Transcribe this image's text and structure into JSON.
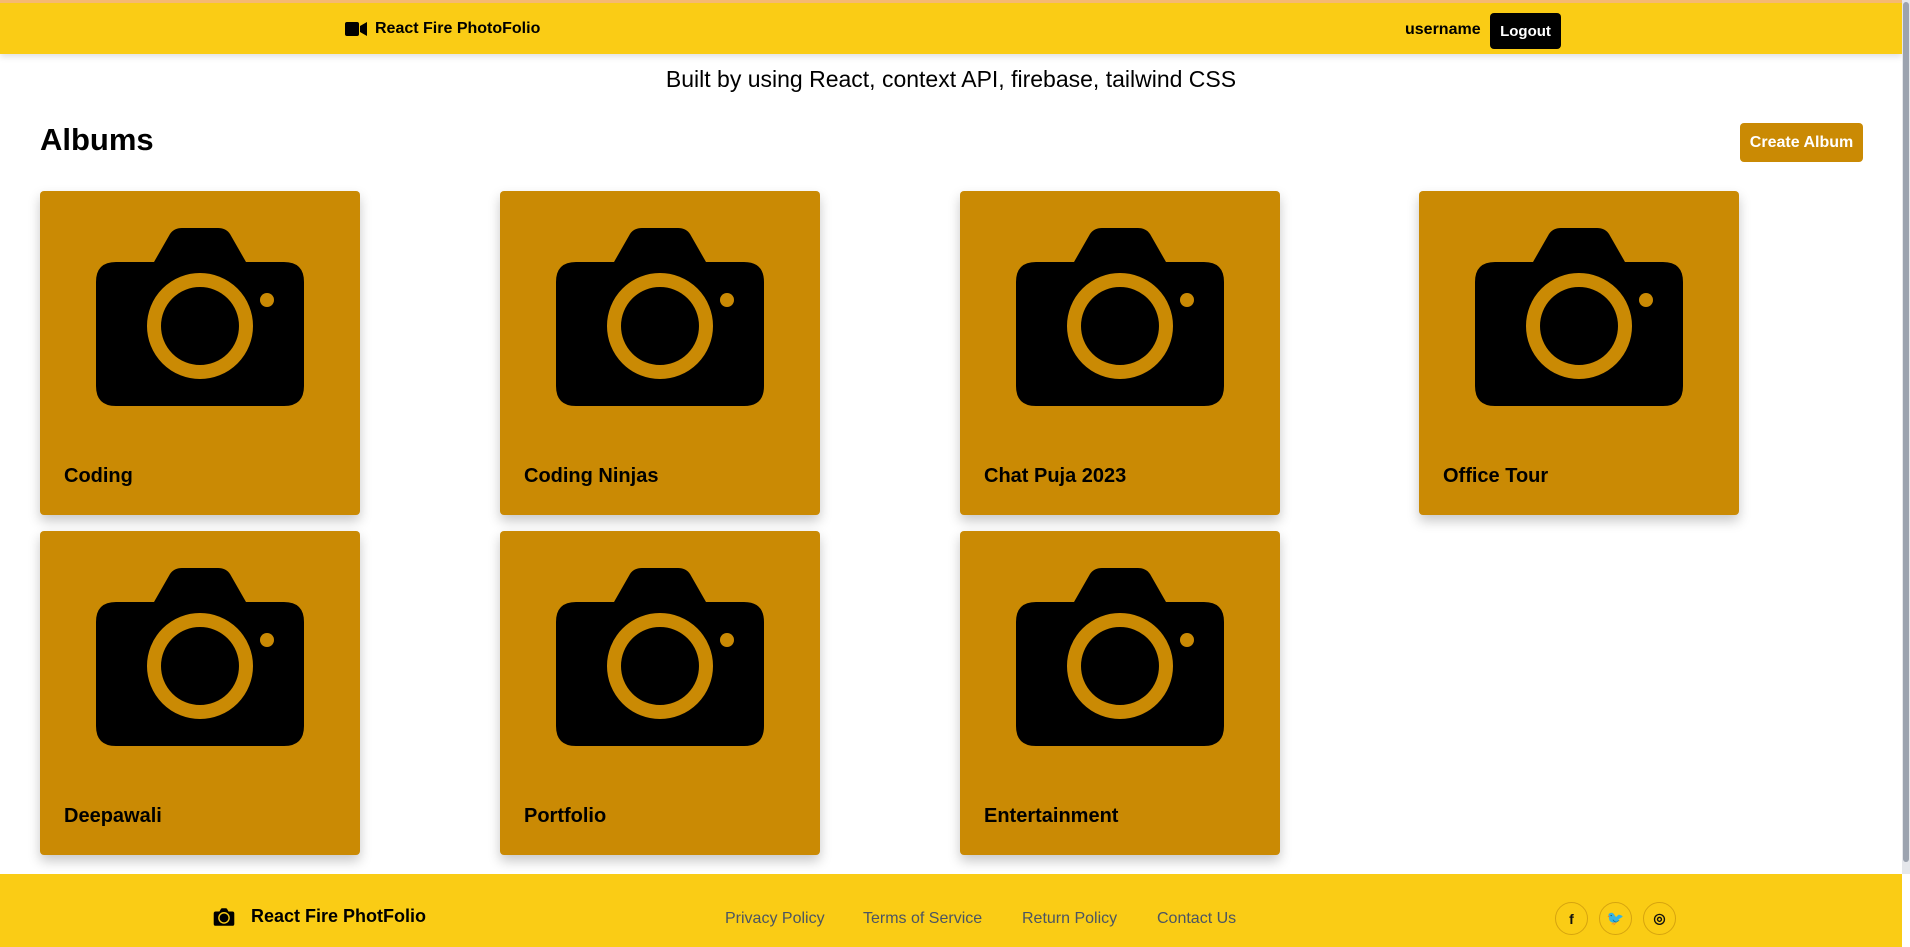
{
  "navbar": {
    "brand": "React Fire PhotoFolio",
    "brand_icon": "video-icon",
    "username": "username",
    "logout_label": "Logout"
  },
  "subtitle": "Built by using React, context API, firebase, tailwind CSS",
  "albums": {
    "title": "Albums",
    "create_label": "Create Album",
    "items": [
      {
        "name": "Coding",
        "icon": "camera-icon"
      },
      {
        "name": "Coding Ninjas",
        "icon": "camera-icon"
      },
      {
        "name": "Chat Puja 2023",
        "icon": "camera-icon"
      },
      {
        "name": "Office Tour",
        "icon": "camera-icon"
      },
      {
        "name": "Deepawali",
        "icon": "camera-icon"
      },
      {
        "name": "Portfolio",
        "icon": "camera-icon"
      },
      {
        "name": "Entertainment",
        "icon": "camera-icon"
      }
    ]
  },
  "footer": {
    "brand": "React Fire PhotFolio",
    "brand_icon": "camera-icon",
    "links": [
      "Privacy Policy",
      "Terms of Service",
      "Return Policy",
      "Contact Us"
    ],
    "social": [
      {
        "icon": "facebook-icon",
        "glyph": "f"
      },
      {
        "icon": "twitter-icon",
        "glyph": "🐦"
      },
      {
        "icon": "instagram-icon",
        "glyph": "◎"
      }
    ]
  },
  "colors": {
    "navbar_bg": "#facc15",
    "card_bg": "#ca8a04",
    "create_button_bg": "#ca8a04",
    "logout_button_bg": "#000000"
  }
}
